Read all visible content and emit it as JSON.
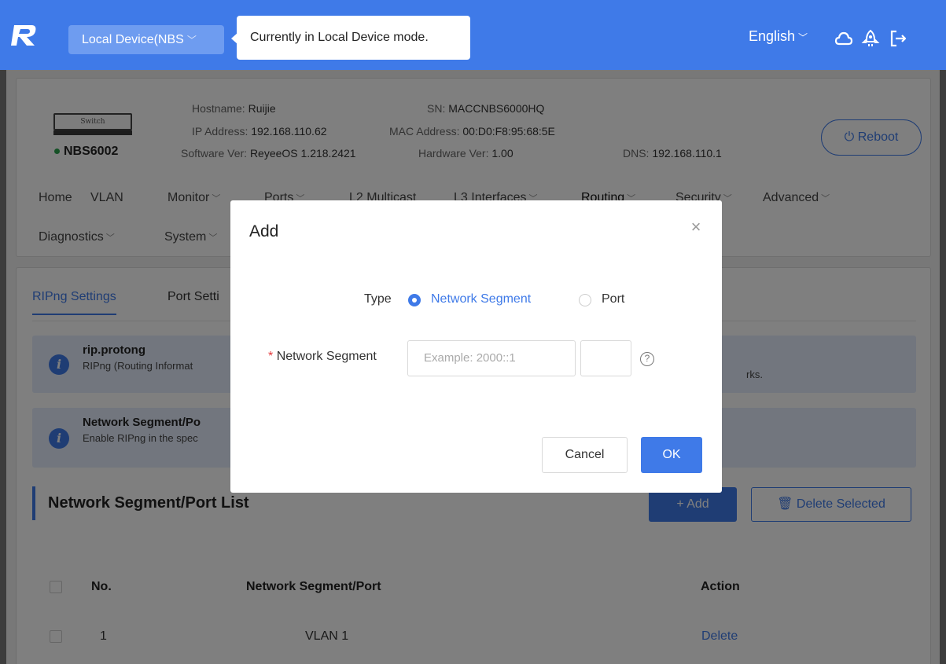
{
  "topbar": {
    "device_select": "Local Device(NBS",
    "tooltip": "Currently in Local Device mode.",
    "language": "English",
    "icons": [
      "logo-icon",
      "cloud-icon",
      "rocket-icon",
      "logout-icon"
    ]
  },
  "device": {
    "image_label": "Switch",
    "model": "NBS6002",
    "status_color": "#2aa24d",
    "hostname_label": "Hostname:",
    "hostname": "Ruijie",
    "ip_label": "IP Address:",
    "ip": "192.168.110.62",
    "software_label": "Software Ver:",
    "software": "ReyeeOS 1.218.2421",
    "sn_label": "SN:",
    "sn": "MACCNBS6000HQ",
    "mac_label": "MAC Address:",
    "mac": "00:D0:F8:95:68:5E",
    "hardware_label": "Hardware Ver:",
    "hardware": "1.00",
    "dns_label": "DNS:",
    "dns": "192.168.110.1",
    "reboot": "Reboot"
  },
  "nav": {
    "row1": [
      "Home",
      "VLAN",
      "Monitor",
      "Ports",
      "L2 Multicast",
      "L3 Interfaces",
      "Routing",
      "Security",
      "Advanced"
    ],
    "row2": [
      "Diagnostics",
      "System"
    ]
  },
  "tabs": {
    "active": "RIPng Settings",
    "other": "Port Setti"
  },
  "alerts": [
    {
      "title": "rip.protong",
      "desc": "RIPng (Routing Informat",
      "tail": "rks."
    },
    {
      "title": "Network Segment/Po",
      "desc": "Enable RIPng in the spec"
    }
  ],
  "list": {
    "title": "Network Segment/Port List",
    "add": "+ Add",
    "delete_selected": "Delete Selected",
    "columns": [
      "No.",
      "Network Segment/Port",
      "Action"
    ],
    "rows": [
      {
        "no": "1",
        "segment": "VLAN 1",
        "action": "Delete"
      }
    ]
  },
  "modal": {
    "title": "Add",
    "type_label": "Type",
    "type_options": [
      "Network Segment",
      "Port"
    ],
    "type_selected": "Network Segment",
    "segment_label": "Network Segment",
    "segment_placeholder": "Example: 2000::1",
    "prefix_value": "",
    "cancel": "Cancel",
    "ok": "OK"
  },
  "colors": {
    "accent": "#3f7ae8",
    "alert_bg": "#e4ecfc",
    "required": "#e4393c"
  }
}
